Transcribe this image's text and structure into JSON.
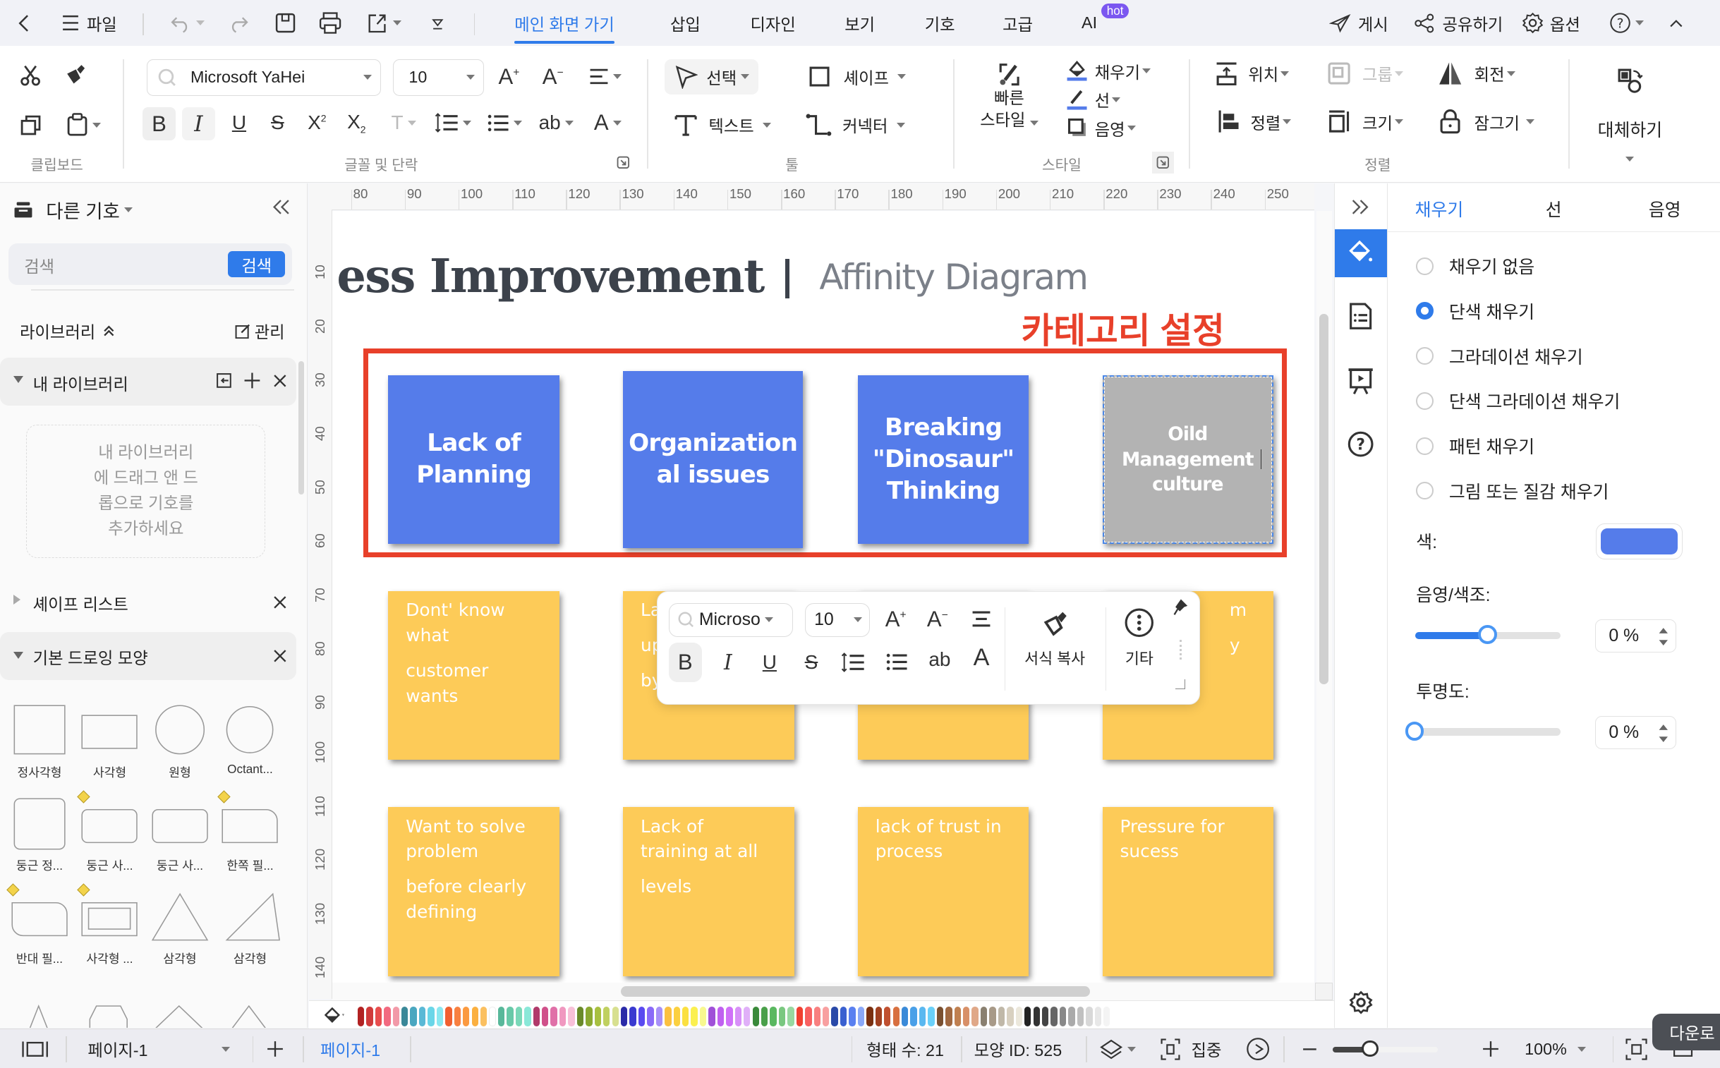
{
  "topbar": {
    "file_label": "파일",
    "tabs": [
      {
        "label": "메인 화면 가기",
        "active": true
      },
      {
        "label": "삽입"
      },
      {
        "label": "디자인"
      },
      {
        "label": "보기"
      },
      {
        "label": "기호"
      },
      {
        "label": "고급"
      },
      {
        "label": "AI",
        "badge": "hot"
      }
    ],
    "publish": "게시",
    "share": "공유하기",
    "options": "옵션"
  },
  "ribbon": {
    "clipboard_label": "클립보드",
    "font_name": "Microsoft YaHei",
    "font_size": "10",
    "font_group_label": "글꼴 및 단락",
    "select": "선택",
    "shape": "셰이프",
    "text": "텍스트",
    "connector": "커넥터",
    "tools_label": "툴",
    "quick_style_line1": "빠른",
    "quick_style_line2": "스타일",
    "fill": "채우기",
    "line": "선",
    "shadow": "음영",
    "style_label": "스타일",
    "position": "위치",
    "group": "그룹",
    "rotate": "회전",
    "align": "정렬",
    "size": "크기",
    "lock": "잠그기",
    "arrange_label": "정렬",
    "replace": "대체하기",
    "accent_color": "#2f7bea"
  },
  "leftpanel": {
    "title": "다른 기호",
    "search_placeholder": "검색",
    "search_button": "검색",
    "library_label": "라이브러리",
    "manage": "관리",
    "my_library": "내 라이브러리",
    "my_library_hint": [
      "내 라이브러리",
      "에 드래그 앤 드",
      "롭으로 기호를",
      "추가하세요"
    ],
    "shape_list": "셰이프 리스트",
    "basic_shapes": "기본 드로잉 모양",
    "shapes": [
      {
        "label": "정사각형",
        "kind": "square"
      },
      {
        "label": "사각형",
        "kind": "rect"
      },
      {
        "label": "원형",
        "kind": "circle"
      },
      {
        "label": "Octant...",
        "kind": "circle2"
      },
      {
        "label": "둥근 정...",
        "kind": "rsquare"
      },
      {
        "label": "둥근 사...",
        "kind": "rrect"
      },
      {
        "label": "둥근 사...",
        "kind": "rrect2"
      },
      {
        "label": "한쪽 필...",
        "kind": "onecorner"
      },
      {
        "label": "반대 필...",
        "kind": "oppcorner"
      },
      {
        "label": "사각형 ...",
        "kind": "framerect"
      },
      {
        "label": "삼각형",
        "kind": "tri"
      },
      {
        "label": "삼각형",
        "kind": "rtri"
      }
    ]
  },
  "ruler": {
    "top": [
      "80",
      "90",
      "100",
      "110",
      "120",
      "130",
      "140",
      "150",
      "160",
      "170",
      "180",
      "190",
      "200",
      "210",
      "220",
      "230",
      "240",
      "250"
    ],
    "left": [
      "10",
      "20",
      "30",
      "40",
      "50",
      "60",
      "70",
      "80",
      "90",
      "100",
      "110",
      "120",
      "130",
      "140"
    ]
  },
  "canvas": {
    "title": "ess Improvement",
    "subtitle": "Affinity Diagram",
    "annotation": "카테고리 설정",
    "annotation_color": "#e8402a",
    "categories": [
      {
        "text": "Lack of Planning"
      },
      {
        "text": "Organization al issues"
      },
      {
        "text": "Breaking \"Dinosaur\" Thinking"
      },
      {
        "text": "Oild Management culture",
        "selected": true
      }
    ],
    "notes_row1": [
      {
        "lines": [
          "Dont' know what",
          "customer wants"
        ]
      },
      {
        "lines": [
          "La",
          "up",
          "by"
        ]
      },
      {
        "lines": [
          ""
        ]
      },
      {
        "lines": [
          "m",
          "y"
        ]
      }
    ],
    "notes_row2": [
      {
        "lines": [
          "Want to solve problem",
          "before clearly defining"
        ]
      },
      {
        "lines": [
          "Lack of training at all",
          "levels"
        ]
      },
      {
        "lines": [
          "lack of trust in process"
        ]
      },
      {
        "lines": [
          "Pressure for sucess"
        ]
      }
    ],
    "category_color": "#557cea",
    "selected_color": "#b3b3b3",
    "note_color": "#fdcb58"
  },
  "floatbar": {
    "font_name": "Microso",
    "font_size": "10",
    "format_painter": "서식 복사",
    "more": "기타"
  },
  "rightpanel": {
    "tabs": [
      "채우기",
      "선",
      "음영"
    ],
    "active_tab": "채우기",
    "fill_options": [
      {
        "label": "채우기 없음",
        "checked": false
      },
      {
        "label": "단색 채우기",
        "checked": true
      },
      {
        "label": "그라데이션 채우기",
        "checked": false
      },
      {
        "label": "단색 그라데이션 채우기",
        "checked": false
      },
      {
        "label": "패턴 채우기",
        "checked": false
      },
      {
        "label": "그림 또는 질감 채우기",
        "checked": false
      }
    ],
    "color_label": "색:",
    "color_value": "#557cea",
    "shade_label": "음영/색조:",
    "shade_value": "0 %",
    "shade_slider_fraction": 0.5,
    "transparency_label": "투명도:",
    "transparency_value": "0 %",
    "transparency_slider_fraction": 0.0
  },
  "palette": [
    "#b22222",
    "#d03a3a",
    "#e84d4d",
    "#f26a80",
    "#f29aa8",
    "#3a8898",
    "#4aa7c0",
    "#5ab9d6",
    "#6ad6e8",
    "#8ae8f0",
    "#f06030",
    "#f88040",
    "#fb9a40",
    "#fbb040",
    "#fbc060",
    "#ffffff",
    "#58b89a",
    "#68c9a8",
    "#7ad8b8",
    "#8ae8d8",
    "#b03a6a",
    "#d0508a",
    "#e070a8",
    "#f098c0",
    "#f8c0d8",
    "#6a8a2a",
    "#8aa830",
    "#a8c040",
    "#c0d060",
    "#d8e090",
    "#2a2aa8",
    "#3a3ad0",
    "#5a4af0",
    "#8a6af8",
    "#a890f8",
    "#fbc040",
    "#fbd040",
    "#fbe040",
    "#fbf050",
    "#f8f890",
    "#a050d8",
    "#c060f0",
    "#d070f8",
    "#d890f8",
    "#e0b0f8",
    "#3a8a3a",
    "#4aa04a",
    "#5ab860",
    "#7ac880",
    "#98d8a0",
    "#f04030",
    "#f86060",
    "#f88080",
    "#f8a0a0",
    "#2a4aa8",
    "#3a60d0",
    "#5a80f0",
    "#8aa8f8",
    "#7a3010",
    "#a04020",
    "#c05030",
    "#d87040",
    "#3a8ad8",
    "#4aa0e8",
    "#5ab8f0",
    "#6ad0f8",
    "#7a5030",
    "#a06840",
    "#c08050",
    "#d89068",
    "#e0a888",
    "#8a8070",
    "#a89a88",
    "#c0b8a8",
    "#d8d0c0",
    "#ece8dc",
    "#222222",
    "#333333",
    "#444444",
    "#666666",
    "#888888",
    "#aaaaaa",
    "#c0c0c0",
    "#d8d8d8",
    "#e8e8e8",
    "#f4f4f4"
  ],
  "statusbar": {
    "page_select": "페이지-1",
    "page_tab": "페이지-1",
    "shape_count": "형태 수: 21",
    "shape_id": "모양 ID: 525",
    "focus": "집중",
    "zoom": "100%",
    "zoom_fraction": 0.35,
    "tooltip": "다운로"
  }
}
